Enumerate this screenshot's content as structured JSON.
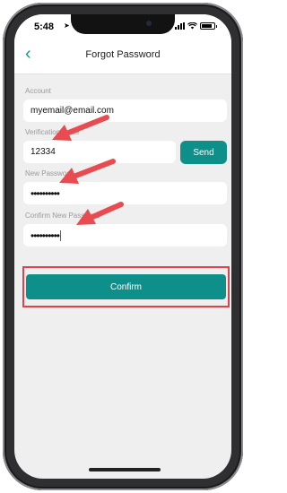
{
  "status_bar": {
    "time": "5:48",
    "location_icon": "location-arrow-icon"
  },
  "nav": {
    "back_icon": "‹",
    "title": "Forgot Password"
  },
  "form": {
    "account": {
      "label": "Account",
      "value": "myemail@email.com"
    },
    "verification": {
      "label": "Verification Code",
      "value": "12334",
      "send_label": "Send"
    },
    "new_password": {
      "label": "New Password",
      "value": "••••••••••"
    },
    "confirm_password": {
      "label": "Confirm New Password",
      "value": "••••••••••"
    }
  },
  "confirm_button": {
    "label": "Confirm"
  },
  "colors": {
    "accent": "#0f8f8a",
    "annotation": "#e0424a"
  }
}
